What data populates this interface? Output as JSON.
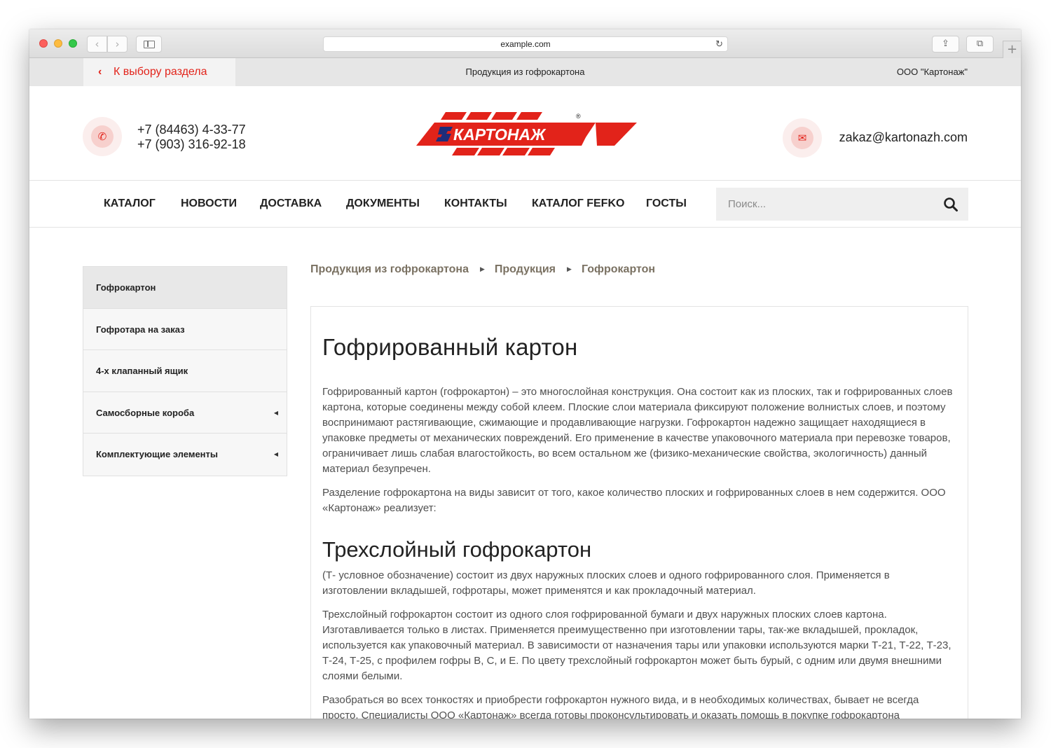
{
  "browser": {
    "url": "example.com"
  },
  "topbar": {
    "back_label": "К выбору раздела",
    "title": "Продукция из гофрокартона",
    "company": "ООО \"Картонаж\""
  },
  "header": {
    "phone_1": "+7 (84463) 4-33-77",
    "phone_2": "+7 (903) 316-92-18",
    "logo_text": "КАРТОНАЖ",
    "logo_mark": "®",
    "email": "zakaz@kartonazh.com"
  },
  "nav": {
    "items": [
      "КАТАЛОГ",
      "НОВОСТИ",
      "ДОСТАВКА",
      "ДОКУМЕНТЫ",
      "КОНТАКТЫ",
      "КАТАЛОГ FEFKO",
      "ГОСТЫ"
    ],
    "search_placeholder": "Поиск..."
  },
  "sidebar": {
    "items": [
      {
        "label": "Гофрокартон",
        "active": true,
        "has_submenu": false
      },
      {
        "label": "Гофротара на заказ",
        "active": false,
        "has_submenu": false
      },
      {
        "label": "4-х клапанный ящик",
        "active": false,
        "has_submenu": false
      },
      {
        "label": "Самосборные короба",
        "active": false,
        "has_submenu": true
      },
      {
        "label": "Комплектующие элементы",
        "active": false,
        "has_submenu": true
      }
    ]
  },
  "breadcrumb": [
    "Продукция из гофрокартона",
    "Продукция",
    "Гофрокартон"
  ],
  "content": {
    "title": "Гофрированный картон",
    "p1": "Гофрированный картон (гофрокартон) – это многослойная конструкция. Она состоит как из плоских, так и гофрированных слоев картона, которые соединены между собой клеем. Плоские слои материала фиксируют положение волнистых слоев, и поэтому воспринимают растягивающие, сжимающие и продавливающие нагрузки. Гофрокартон надежно защищает находящиеся в упаковке предметы от механических повреждений. Его применение в качестве упаковочного материала при перевозке товаров, ограничивает лишь слабая влагостойкость, во всем остальном же (физико-механические свойства, экологичность) данный материал безупречен.",
    "p2": "Разделение гофрокартона на виды зависит от того, какое количество плоских и гофрированных слоев в нем содержится. ООО «Картонаж» реализует:",
    "subtitle": "Трехслойный гофрокартон",
    "p3": "(Т- условное обозначение) состоит из двух наружных плоских слоев и одного гофрированного слоя. Применяется в изготовлении вкладышей, гофротары, может применятся и как прокладочный материал.",
    "p4": "Трехслойный гофрокартон состоит из одного слоя гофрированной бумаги и двух наружных плоских слоев картона. Изготавливается только в листах. Применяется преимущественно при изготовлении тары, так-же вкладышей, прокладок, используется как упаковочный материал. В зависимости от назначения тары или упаковки используются марки Т-21, Т-22, Т-23, Т-24, Т-25, с профилем гофры В, С, и Е. По цвету трехслойный гофрокартон может быть бурый, с одним или двумя внешними слоями белыми.",
    "p5": "Разобраться во всех тонкостях и приобрести гофрокартон нужного вида, и в необходимых количествах, бывает не всегда просто. Специалисты ООО «Картонаж» всегда готовы проконсультировать и оказать помощь в покупке гофрокартона"
  },
  "colors": {
    "brand_red": "#e2231a",
    "breadcrumb": "#7a7162"
  }
}
